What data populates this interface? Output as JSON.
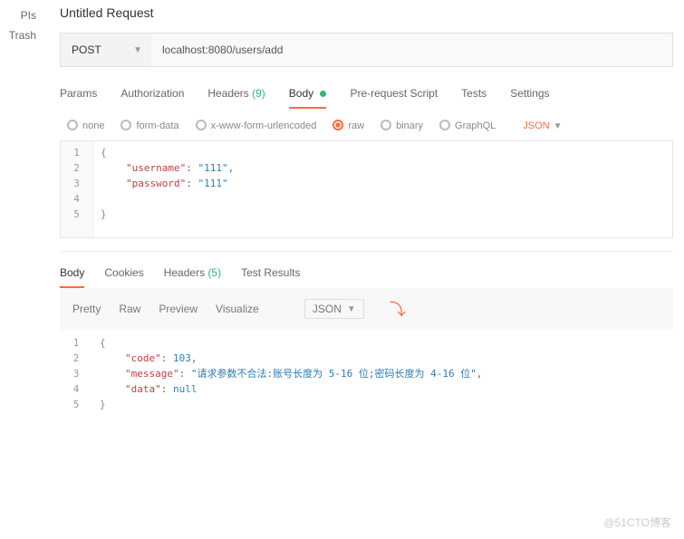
{
  "sidebar": {
    "apis": "PIs",
    "trash": "Trash"
  },
  "title": "Untitled Request",
  "method": "POST",
  "url": "localhost:8080/users/add",
  "tabs": {
    "params": "Params",
    "auth": "Authorization",
    "headers": "Headers",
    "headers_count": "(9)",
    "body": "Body",
    "prereq": "Pre-request Script",
    "tests": "Tests",
    "settings": "Settings"
  },
  "body_types": {
    "none": "none",
    "formdata": "form-data",
    "xwww": "x-www-form-urlencoded",
    "raw": "raw",
    "binary": "binary",
    "graphql": "GraphQL",
    "json": "JSON"
  },
  "request_body": {
    "line_numbers": [
      "1",
      "2",
      "3",
      "4",
      "5"
    ],
    "k_username": "\"username\"",
    "v_username": "\"111\"",
    "k_password": "\"password\"",
    "v_password": "\"111\""
  },
  "resp_tabs": {
    "body": "Body",
    "cookies": "Cookies",
    "headers": "Headers",
    "headers_count": "(5)",
    "results": "Test Results"
  },
  "resp_toolbar": {
    "pretty": "Pretty",
    "raw": "Raw",
    "preview": "Preview",
    "visualize": "Visualize",
    "json": "JSON"
  },
  "response_body": {
    "line_numbers": [
      "1",
      "2",
      "3",
      "4",
      "5"
    ],
    "k_code": "\"code\"",
    "v_code": "103",
    "k_message": "\"message\"",
    "v_message": "\"请求参数不合法:账号长度为 5-16 位;密码长度为 4-16 位\"",
    "k_data": "\"data\"",
    "v_data": "null"
  },
  "watermark": "@51CTO博客"
}
